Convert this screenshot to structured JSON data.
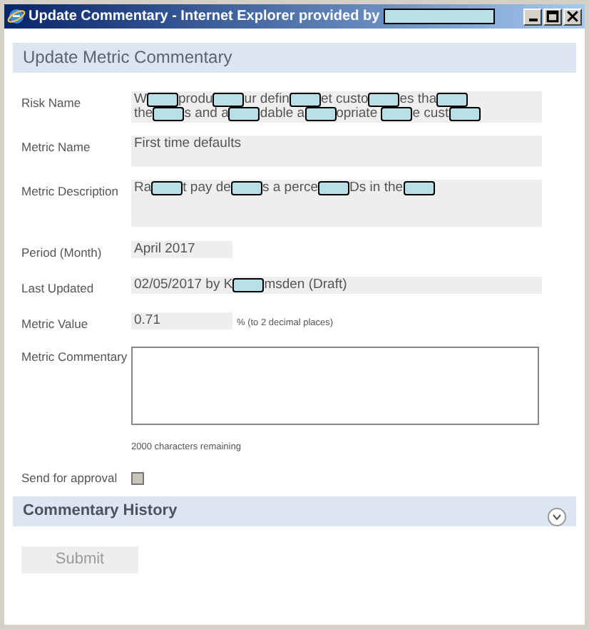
{
  "window": {
    "title_parts": [
      {
        "kind": "text",
        "text": "Update Commentary - Internet Explorer provided by"
      },
      {
        "kind": "redacted"
      }
    ]
  },
  "header": "Update Metric Commentary",
  "fields": [
    {
      "label": "Risk Name",
      "kind": "text",
      "lines": [
        [
          {
            "kind": "text",
            "text": "W"
          },
          {
            "kind": "redacted"
          },
          {
            "kind": "text",
            "text": "produ"
          },
          {
            "kind": "redacted"
          },
          {
            "kind": "text",
            "text": "ur defin"
          },
          {
            "kind": "redacted"
          },
          {
            "kind": "text",
            "text": "et custo"
          },
          {
            "kind": "redacted"
          },
          {
            "kind": "text",
            "text": "es tha"
          },
          {
            "kind": "redacted"
          }
        ],
        [
          {
            "kind": "text",
            "text": "the"
          },
          {
            "kind": "redacted"
          },
          {
            "kind": "text",
            "text": "s and a"
          },
          {
            "kind": "redacted"
          },
          {
            "kind": "text",
            "text": "dable a"
          },
          {
            "kind": "redacted"
          },
          {
            "kind": "text",
            "text": "opriate "
          },
          {
            "kind": "redacted"
          },
          {
            "kind": "text",
            "text": "e cust"
          },
          {
            "kind": "redacted"
          }
        ]
      ]
    },
    {
      "label": "Metric Name",
      "kind": "text",
      "lines": [
        [
          {
            "kind": "text",
            "text": "First time defaults"
          }
        ]
      ]
    },
    {
      "label": "Metric Description",
      "kind": "tall",
      "lines": [
        [
          {
            "kind": "text",
            "text": "Ra"
          },
          {
            "kind": "redacted"
          },
          {
            "kind": "text",
            "text": "t pay de"
          },
          {
            "kind": "redacted"
          },
          {
            "kind": "text",
            "text": "s a perce"
          },
          {
            "kind": "redacted"
          },
          {
            "kind": "text",
            "text": "Ds in the"
          },
          {
            "kind": "redacted"
          }
        ]
      ]
    },
    {
      "label": "Period (Month)",
      "kind": "short",
      "lines": [
        [
          {
            "kind": "text",
            "text": "April 2017"
          }
        ]
      ]
    },
    {
      "label": "Last Updated",
      "kind": "wide",
      "lines": [
        [
          {
            "kind": "text",
            "text": "02/05/2017 by K"
          },
          {
            "kind": "redacted"
          },
          {
            "kind": "text",
            "text": "msden (Draft)"
          }
        ]
      ]
    },
    {
      "label": "Metric Value",
      "kind": "short",
      "lines": [
        [
          {
            "kind": "text",
            "text": "0.71"
          }
        ]
      ],
      "suffix": "% (to 2 decimal places)"
    }
  ],
  "commentary": {
    "label": "Metric Commentary",
    "remaining": "2000 characters remaining"
  },
  "approval": {
    "label": "Send for approval",
    "checked": false
  },
  "history": {
    "title": "Commentary History",
    "expanded": false
  },
  "submit": {
    "label": "Submit",
    "disabled": true
  }
}
